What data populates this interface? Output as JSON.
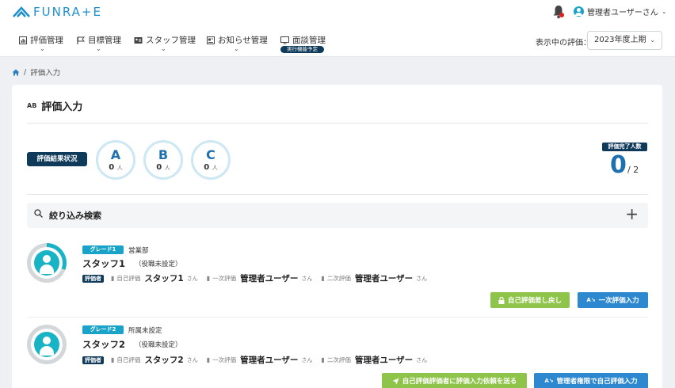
{
  "header": {
    "logo_text": "FUNRA+E",
    "user_name": "管理者ユーザーさん",
    "accent_color": "#1d8fd0"
  },
  "nav": {
    "items": [
      {
        "label": "評価管理",
        "icon": "chart-icon"
      },
      {
        "label": "目標管理",
        "icon": "flag-icon"
      },
      {
        "label": "スタッフ管理",
        "icon": "id-card-icon"
      },
      {
        "label": "お知らせ管理",
        "icon": "newspaper-icon"
      },
      {
        "label": "面談管理",
        "icon": "monitor-icon",
        "badge": "実行機能予定"
      }
    ],
    "period_label": "表示中の評価：",
    "period_value": "2023年度上期"
  },
  "breadcrumb": {
    "current": "評価入力"
  },
  "card": {
    "title_icon_text": "AB",
    "title": "評価入力",
    "status_label": "評価結果状況",
    "grades": [
      {
        "letter": "A",
        "count": "0",
        "unit": "人"
      },
      {
        "letter": "B",
        "count": "0",
        "unit": "人"
      },
      {
        "letter": "C",
        "count": "0",
        "unit": "人"
      }
    ],
    "done_label": "評価完了人数",
    "done_count": "0",
    "done_total": "/ 2",
    "search_label": "絞り込み検索",
    "search_toggle": "+"
  },
  "staff": [
    {
      "grade": "グレード1",
      "dept": "営業部",
      "name": "スタッフ1",
      "role": "（役職未設定）",
      "evaluator_tag": "評価者",
      "self_label": "自己評価",
      "self_name": "スタッフ1",
      "first_label": "一次評価",
      "first_name": "管理者ユーザー",
      "second_label": "二次評価",
      "second_name": "管理者ユーザー",
      "san": "さん",
      "progress": 0.3,
      "buttons": [
        {
          "label": "自己評価差し戻し",
          "color": "green",
          "icon": "lock-icon"
        },
        {
          "label": "一次評価入力",
          "color": "blue",
          "icon": "ab-check-icon"
        }
      ]
    },
    {
      "grade": "グレード2",
      "dept": "所属未設定",
      "name": "スタッフ2",
      "role": "（役職未設定）",
      "evaluator_tag": "評価者",
      "self_label": "自己評価",
      "self_name": "スタッフ2",
      "first_label": "一次評価",
      "first_name": "管理者ユーザー",
      "second_label": "二次評価",
      "second_name": "管理者ユーザー",
      "san": "さん",
      "progress": 0,
      "buttons": [
        {
          "label": "自己評価評価者に評価入力依頼を送る",
          "color": "green",
          "icon": "send-icon"
        },
        {
          "label": "管理者権限で自己評価入力",
          "color": "blue",
          "icon": "ab-check-icon"
        }
      ]
    }
  ]
}
